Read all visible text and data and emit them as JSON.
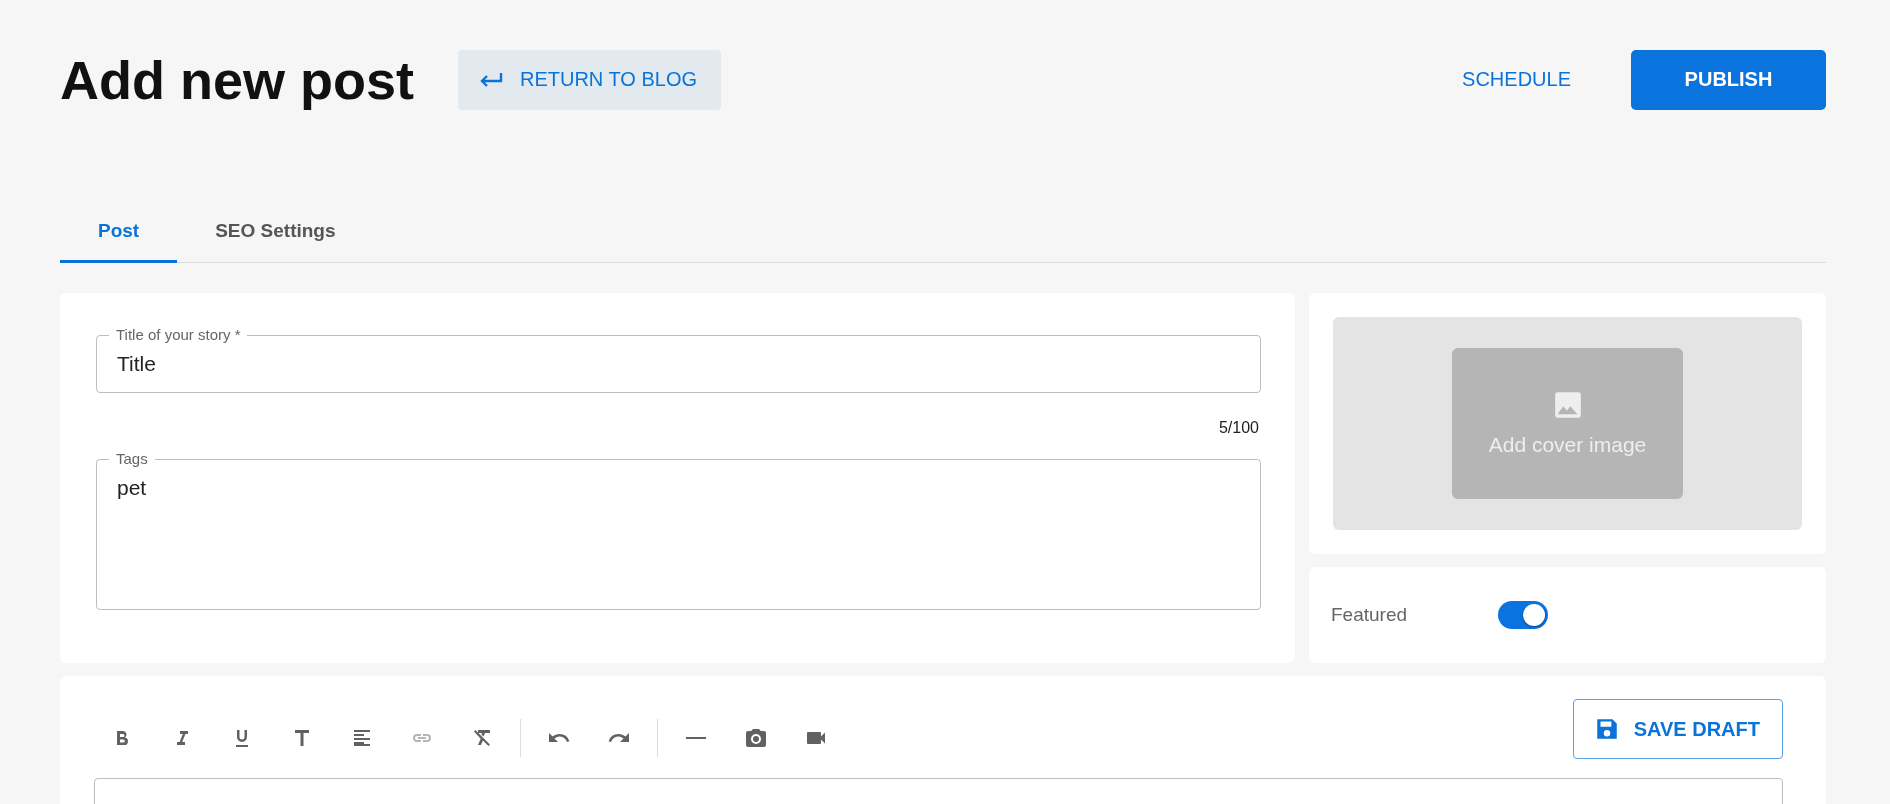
{
  "header": {
    "title": "Add new post",
    "return_button": "RETURN TO BLOG",
    "schedule_button": "SCHEDULE",
    "publish_button": "PUBLISH"
  },
  "tabs": [
    {
      "label": "Post",
      "selected": true
    },
    {
      "label": "SEO Settings",
      "selected": false
    }
  ],
  "title_field": {
    "label": "Title of your story *",
    "value": "Title",
    "counter": "5/100"
  },
  "tags_field": {
    "label": "Tags",
    "value": "pet"
  },
  "cover": {
    "label": "Add cover image"
  },
  "featured": {
    "label": "Featured",
    "on": true
  },
  "toolbar": [
    {
      "kind": "bold"
    },
    {
      "kind": "italic"
    },
    {
      "kind": "underline"
    },
    {
      "kind": "text"
    },
    {
      "kind": "align"
    },
    {
      "kind": "link",
      "disabled": true
    },
    {
      "kind": "clear"
    },
    {
      "kind": "separator"
    },
    {
      "kind": "undo"
    },
    {
      "kind": "redo"
    },
    {
      "kind": "separator"
    },
    {
      "kind": "rule"
    },
    {
      "kind": "camera"
    },
    {
      "kind": "video"
    }
  ],
  "save_draft_button": "SAVE DRAFT"
}
